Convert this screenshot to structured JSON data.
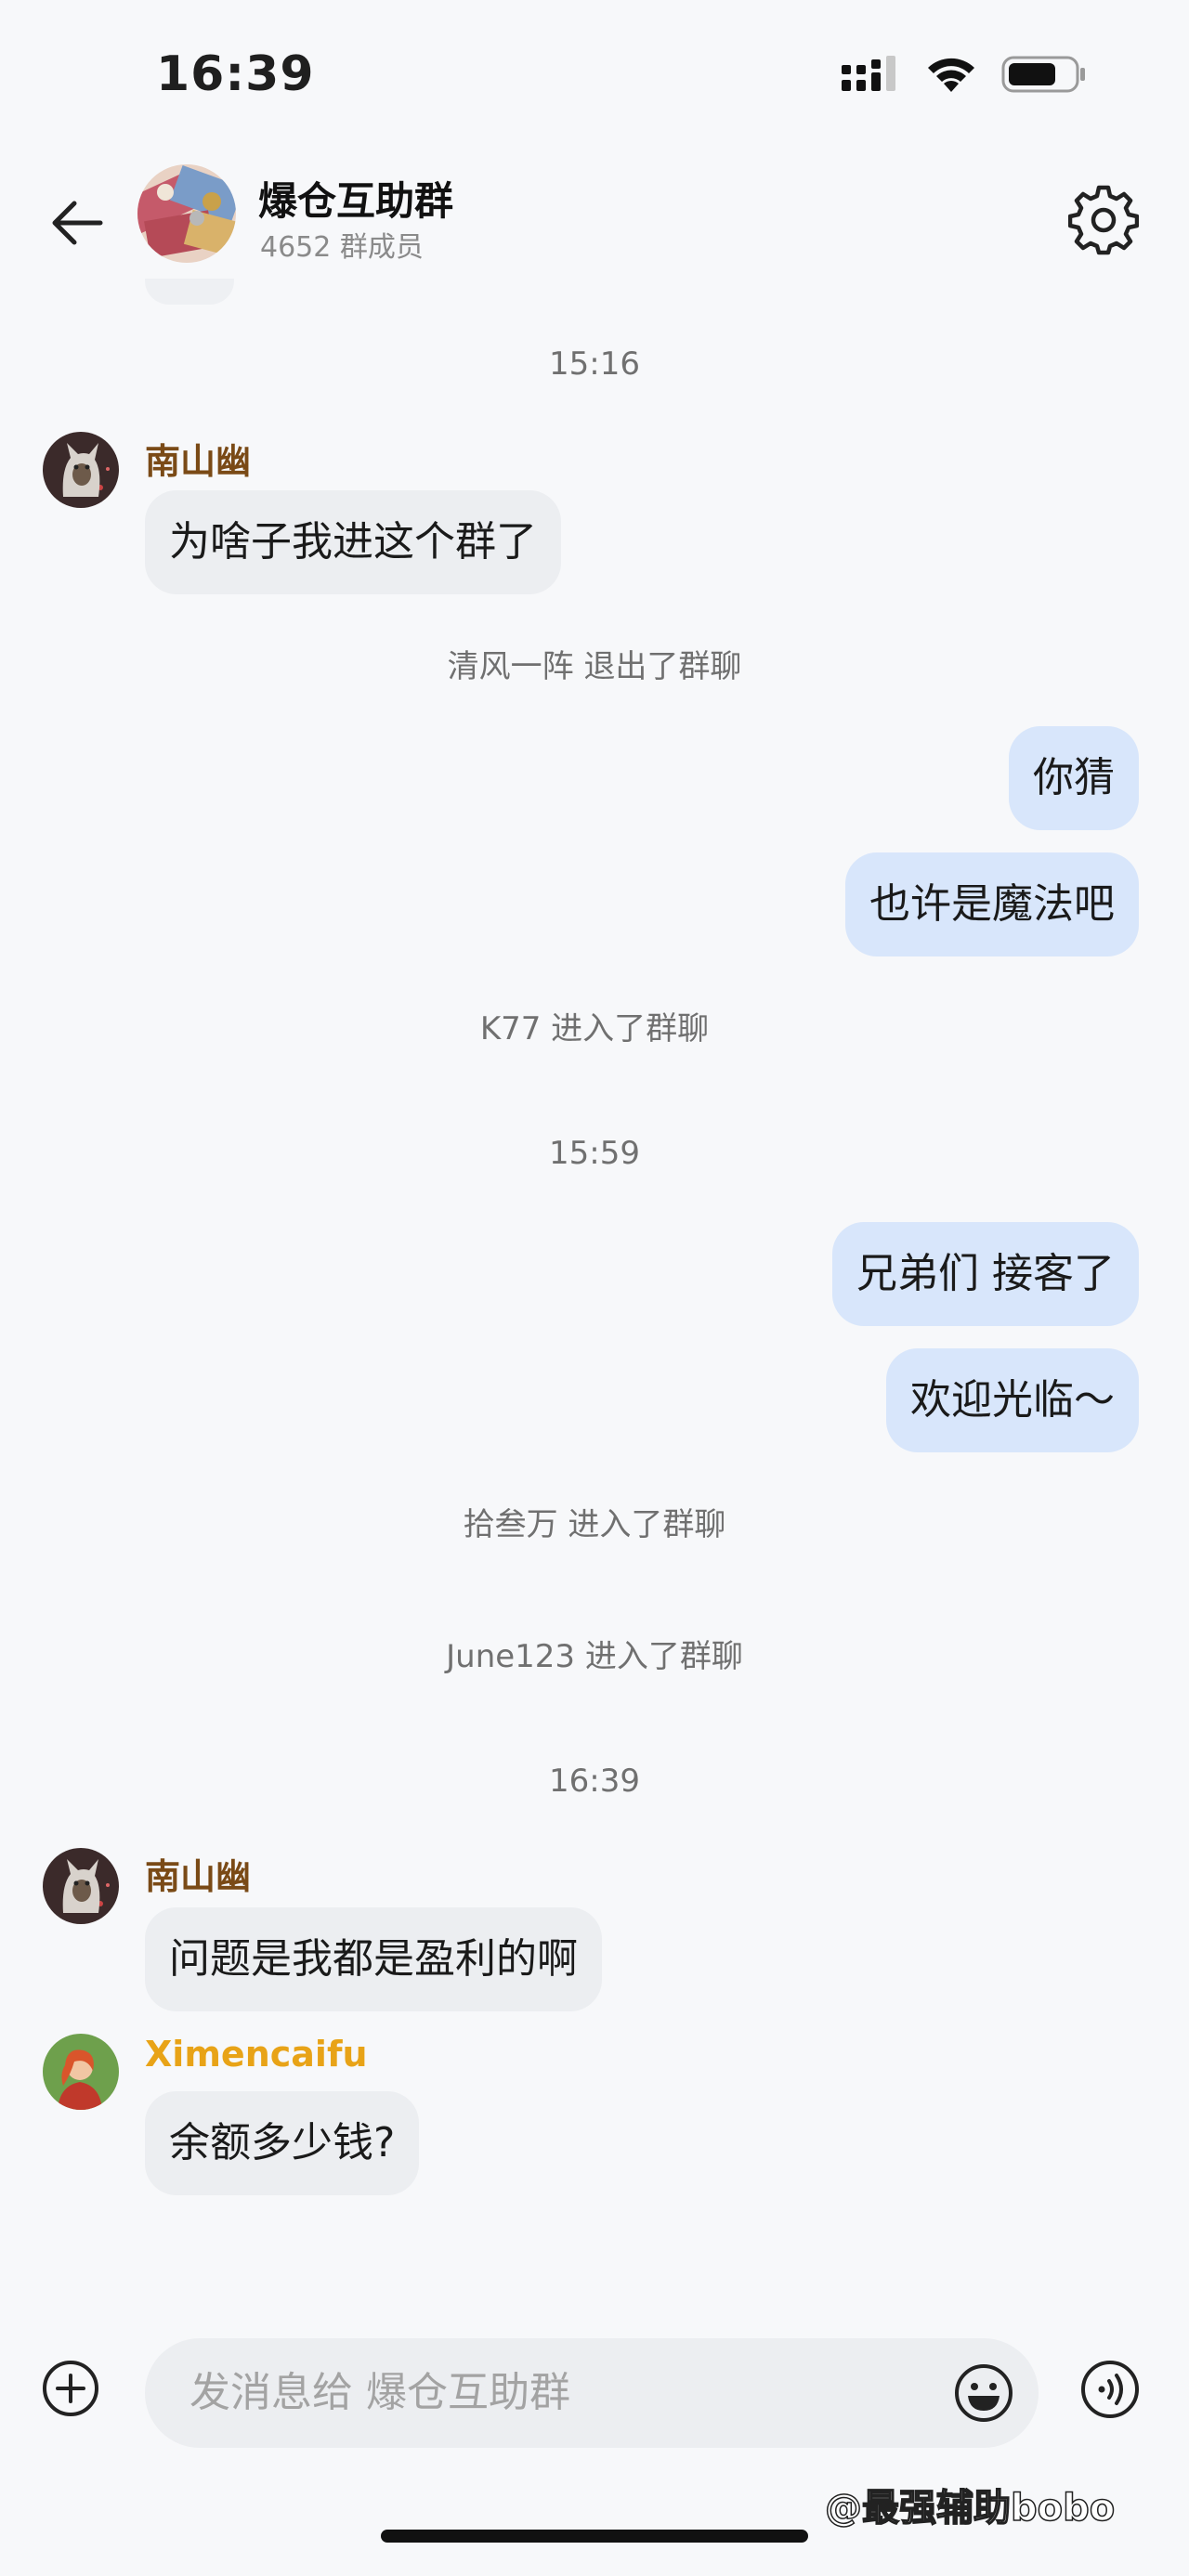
{
  "status_bar": {
    "time": "16:39"
  },
  "header": {
    "title": "爆仓互助群",
    "members": "4652 群成员"
  },
  "chat": {
    "timestamps": [
      "15:16",
      "15:59",
      "16:39"
    ],
    "system_messages": [
      "清风一阵 退出了群聊",
      "K77 进入了群聊",
      "拾叁万 进入了群聊",
      "June123 进入了群聊"
    ],
    "senders": {
      "nanshanyou": {
        "name": "南山幽",
        "color": "#7a4a16"
      },
      "ximencaifu": {
        "name": "Ximencaifu",
        "color": "#e8a317"
      }
    },
    "incoming": [
      "为啥子我进这个群了",
      "问题是我都是盈利的啊",
      "余额多少钱?"
    ],
    "outgoing": [
      "你猜",
      "也许是魔法吧",
      "兄弟们 接客了",
      "欢迎光临～"
    ]
  },
  "input": {
    "placeholder": "发消息给 爆仓互助群"
  },
  "watermark": "@最强辅助bobo",
  "colors": {
    "outgoing_bubble": "#d8e6fb",
    "incoming_bubble": "#eceef1"
  }
}
